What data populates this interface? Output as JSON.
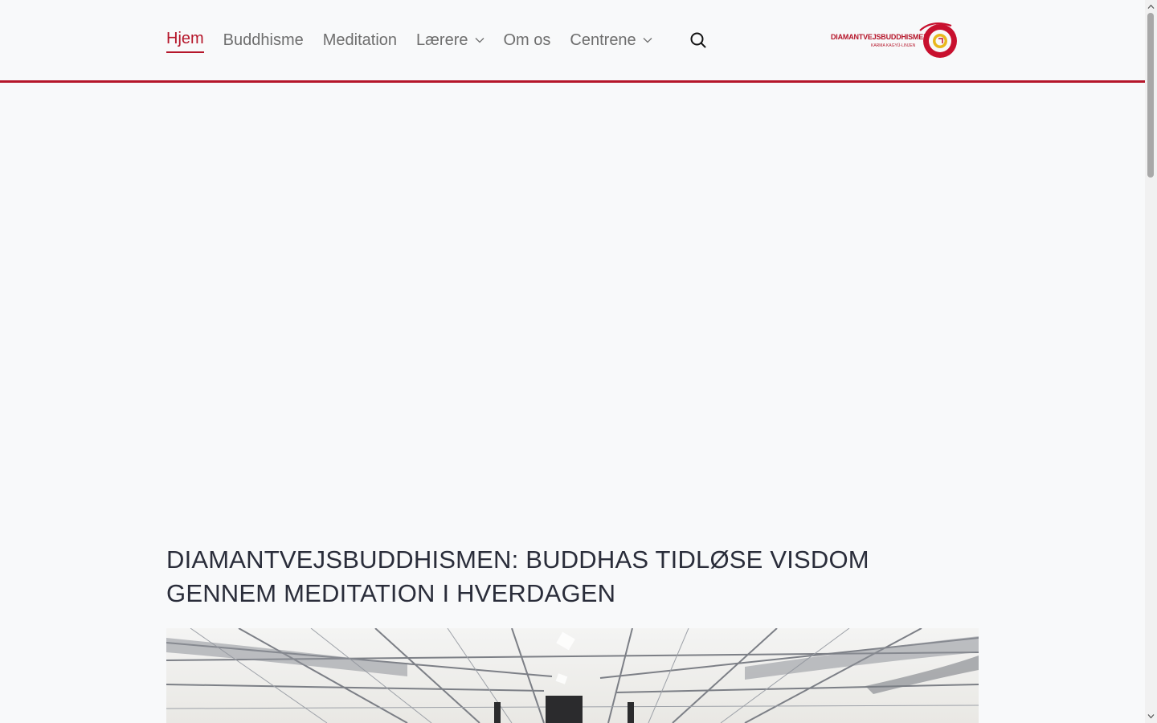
{
  "nav": {
    "items": [
      {
        "label": "Hjem",
        "active": true,
        "has_dropdown": false
      },
      {
        "label": "Buddhisme",
        "active": false,
        "has_dropdown": false
      },
      {
        "label": "Meditation",
        "active": false,
        "has_dropdown": false
      },
      {
        "label": "Lærere",
        "active": false,
        "has_dropdown": true
      },
      {
        "label": "Om os",
        "active": false,
        "has_dropdown": false
      },
      {
        "label": "Centrene",
        "active": false,
        "has_dropdown": true
      }
    ],
    "search_icon": "search-icon"
  },
  "logo": {
    "text": "DIAMANTVEJSBUDDHISME",
    "subtext": "KARMA KAGYÜ-LINJEN"
  },
  "main": {
    "headline": "DIAMANTVEJSBUDDHISMEN: BUDDHAS TIDLØSE VISDOM GENNEM MEDITATION I HVERDAGEN"
  },
  "colors": {
    "accent": "#b5162a",
    "nav_text": "#6e6e6e",
    "heading": "#2a2d3a",
    "background": "#f8f9fa"
  }
}
